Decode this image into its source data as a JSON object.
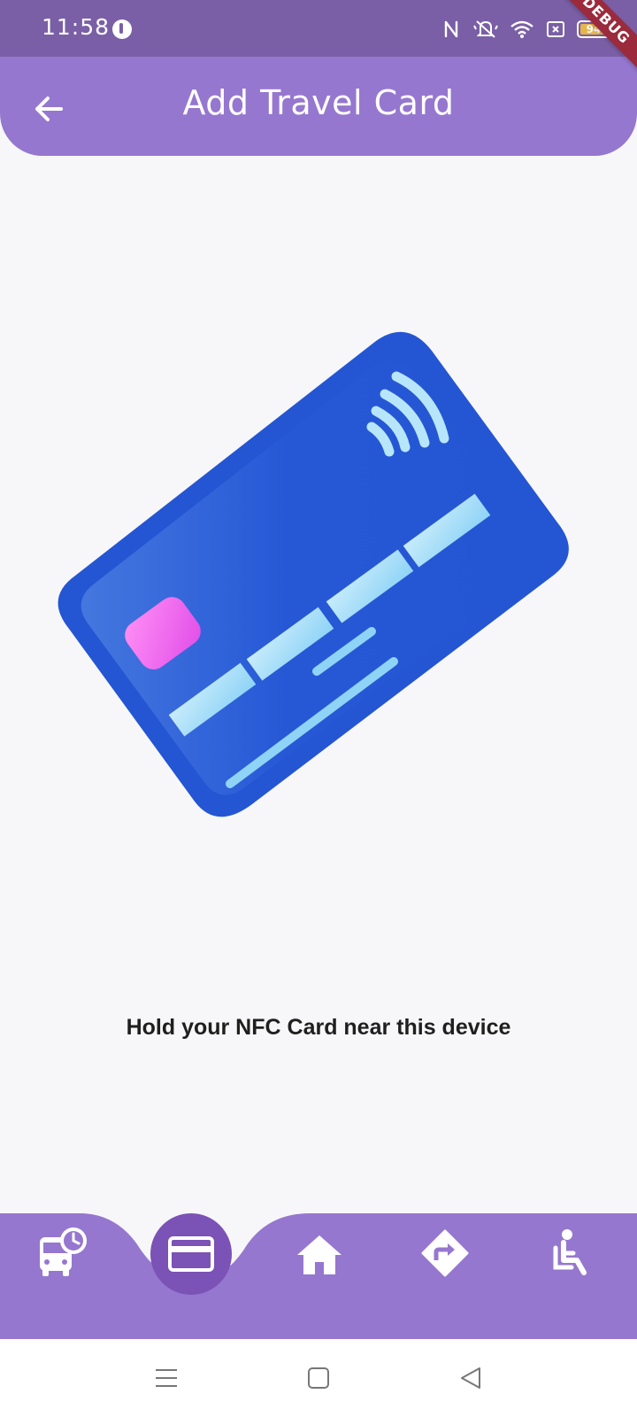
{
  "status_bar": {
    "time": "11:58",
    "battery_level": "94",
    "icons": [
      "nfc-icon",
      "mute-icon",
      "wifi-icon",
      "sim-icon",
      "battery-icon"
    ]
  },
  "debug_banner": "DEBUG",
  "app_bar": {
    "title": "Add Travel Card",
    "back_icon": "arrow-left-icon"
  },
  "illustration": {
    "name": "nfc-card-illustration",
    "colors": {
      "card": "#2456d3",
      "chip": "#e46bf0",
      "stripes": "#9fdcf8"
    }
  },
  "instruction_text": "Hold your NFC Card near this device",
  "bottom_nav": {
    "background": "#9677cf",
    "items": [
      {
        "icon": "bus-schedule-icon",
        "active": false
      },
      {
        "icon": "card-icon",
        "active": true
      },
      {
        "icon": "home-icon",
        "active": false
      },
      {
        "icon": "directions-icon",
        "active": false
      },
      {
        "icon": "accessibility-icon",
        "active": false
      }
    ]
  },
  "system_nav": {
    "icons": [
      "menu-icon",
      "home-square-icon",
      "back-triangle-icon"
    ]
  }
}
